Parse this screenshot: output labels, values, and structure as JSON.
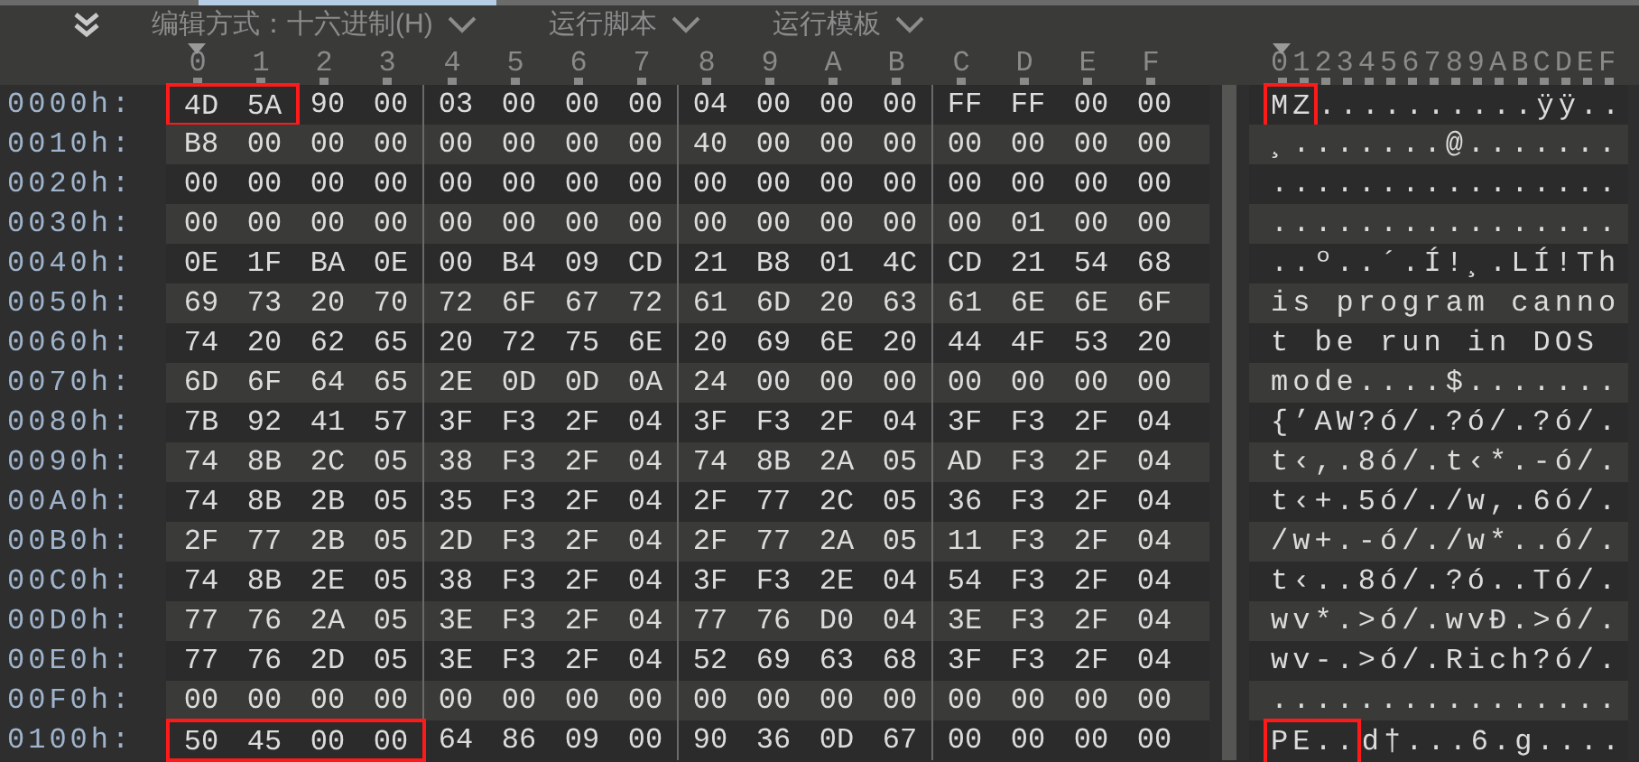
{
  "toolbar": {
    "items": [
      {
        "label": "编辑方式：十六进制(H)"
      },
      {
        "label": "运行脚本"
      },
      {
        "label": "运行模板"
      }
    ]
  },
  "columns": [
    {
      "label": "0",
      "selected": true
    },
    {
      "label": "1",
      "selected": false
    },
    {
      "label": "2",
      "selected": false
    },
    {
      "label": "3",
      "selected": false
    },
    {
      "label": "4",
      "selected": false
    },
    {
      "label": "5",
      "selected": false
    },
    {
      "label": "6",
      "selected": false
    },
    {
      "label": "7",
      "selected": false
    },
    {
      "label": "8",
      "selected": false
    },
    {
      "label": "9",
      "selected": false
    },
    {
      "label": "A",
      "selected": false
    },
    {
      "label": "B",
      "selected": false
    },
    {
      "label": "C",
      "selected": false
    },
    {
      "label": "D",
      "selected": false
    },
    {
      "label": "E",
      "selected": false
    },
    {
      "label": "F",
      "selected": false
    }
  ],
  "ascii_header": "0123456789ABCDEF",
  "rows": [
    {
      "offset": "0000h:",
      "marked_bytes": [
        "4D",
        "5A"
      ],
      "bytes": [
        "90",
        "00",
        "03",
        "00",
        "00",
        "00",
        "04",
        "00",
        "00",
        "00",
        "FF",
        "FF",
        "00",
        "00"
      ],
      "marked_ascii": "MZ",
      "ascii": "..........ÿÿ.."
    },
    {
      "offset": "0010h:",
      "bytes": [
        "B8",
        "00",
        "00",
        "00",
        "00",
        "00",
        "00",
        "00",
        "40",
        "00",
        "00",
        "00",
        "00",
        "00",
        "00",
        "00"
      ],
      "ascii": "¸.......@......."
    },
    {
      "offset": "0020h:",
      "bytes": [
        "00",
        "00",
        "00",
        "00",
        "00",
        "00",
        "00",
        "00",
        "00",
        "00",
        "00",
        "00",
        "00",
        "00",
        "00",
        "00"
      ],
      "ascii": "................"
    },
    {
      "offset": "0030h:",
      "bytes": [
        "00",
        "00",
        "00",
        "00",
        "00",
        "00",
        "00",
        "00",
        "00",
        "00",
        "00",
        "00",
        "00",
        "01",
        "00",
        "00"
      ],
      "ascii": "................"
    },
    {
      "offset": "0040h:",
      "bytes": [
        "0E",
        "1F",
        "BA",
        "0E",
        "00",
        "B4",
        "09",
        "CD",
        "21",
        "B8",
        "01",
        "4C",
        "CD",
        "21",
        "54",
        "68"
      ],
      "ascii": "..º..´.Í!¸.LÍ!Th"
    },
    {
      "offset": "0050h:",
      "bytes": [
        "69",
        "73",
        "20",
        "70",
        "72",
        "6F",
        "67",
        "72",
        "61",
        "6D",
        "20",
        "63",
        "61",
        "6E",
        "6E",
        "6F"
      ],
      "ascii": "is program canno"
    },
    {
      "offset": "0060h:",
      "bytes": [
        "74",
        "20",
        "62",
        "65",
        "20",
        "72",
        "75",
        "6E",
        "20",
        "69",
        "6E",
        "20",
        "44",
        "4F",
        "53",
        "20"
      ],
      "ascii": "t be run in DOS "
    },
    {
      "offset": "0070h:",
      "bytes": [
        "6D",
        "6F",
        "64",
        "65",
        "2E",
        "0D",
        "0D",
        "0A",
        "24",
        "00",
        "00",
        "00",
        "00",
        "00",
        "00",
        "00"
      ],
      "ascii": "mode....$......."
    },
    {
      "offset": "0080h:",
      "bytes": [
        "7B",
        "92",
        "41",
        "57",
        "3F",
        "F3",
        "2F",
        "04",
        "3F",
        "F3",
        "2F",
        "04",
        "3F",
        "F3",
        "2F",
        "04"
      ],
      "ascii": "{’AW?ó/.?ó/.?ó/."
    },
    {
      "offset": "0090h:",
      "bytes": [
        "74",
        "8B",
        "2C",
        "05",
        "38",
        "F3",
        "2F",
        "04",
        "74",
        "8B",
        "2A",
        "05",
        "AD",
        "F3",
        "2F",
        "04"
      ],
      "ascii": "t‹,.8ó/.t‹*.-ó/."
    },
    {
      "offset": "00A0h:",
      "bytes": [
        "74",
        "8B",
        "2B",
        "05",
        "35",
        "F3",
        "2F",
        "04",
        "2F",
        "77",
        "2C",
        "05",
        "36",
        "F3",
        "2F",
        "04"
      ],
      "ascii": "t‹+.5ó/./w,.6ó/."
    },
    {
      "offset": "00B0h:",
      "bytes": [
        "2F",
        "77",
        "2B",
        "05",
        "2D",
        "F3",
        "2F",
        "04",
        "2F",
        "77",
        "2A",
        "05",
        "11",
        "F3",
        "2F",
        "04"
      ],
      "ascii": "/w+.-ó/./w*..ó/."
    },
    {
      "offset": "00C0h:",
      "bytes": [
        "74",
        "8B",
        "2E",
        "05",
        "38",
        "F3",
        "2F",
        "04",
        "3F",
        "F3",
        "2E",
        "04",
        "54",
        "F3",
        "2F",
        "04"
      ],
      "ascii": "t‹..8ó/.?ó..Tó/."
    },
    {
      "offset": "00D0h:",
      "bytes": [
        "77",
        "76",
        "2A",
        "05",
        "3E",
        "F3",
        "2F",
        "04",
        "77",
        "76",
        "D0",
        "04",
        "3E",
        "F3",
        "2F",
        "04"
      ],
      "ascii": "wv*.>ó/.wvÐ.>ó/."
    },
    {
      "offset": "00E0h:",
      "bytes": [
        "77",
        "76",
        "2D",
        "05",
        "3E",
        "F3",
        "2F",
        "04",
        "52",
        "69",
        "63",
        "68",
        "3F",
        "F3",
        "2F",
        "04"
      ],
      "ascii": "wv-.>ó/.Rich?ó/."
    },
    {
      "offset": "00F0h:",
      "bytes": [
        "00",
        "00",
        "00",
        "00",
        "00",
        "00",
        "00",
        "00",
        "00",
        "00",
        "00",
        "00",
        "00",
        "00",
        "00",
        "00"
      ],
      "ascii": "................"
    },
    {
      "offset": "0100h:",
      "marked_bytes": [
        "50",
        "45",
        "00",
        "00"
      ],
      "bytes": [
        "64",
        "86",
        "09",
        "00",
        "90",
        "36",
        "0D",
        "67",
        "00",
        "00",
        "00",
        "00"
      ],
      "marked_ascii": "PE..",
      "ascii": "d†...6.g...."
    }
  ]
}
